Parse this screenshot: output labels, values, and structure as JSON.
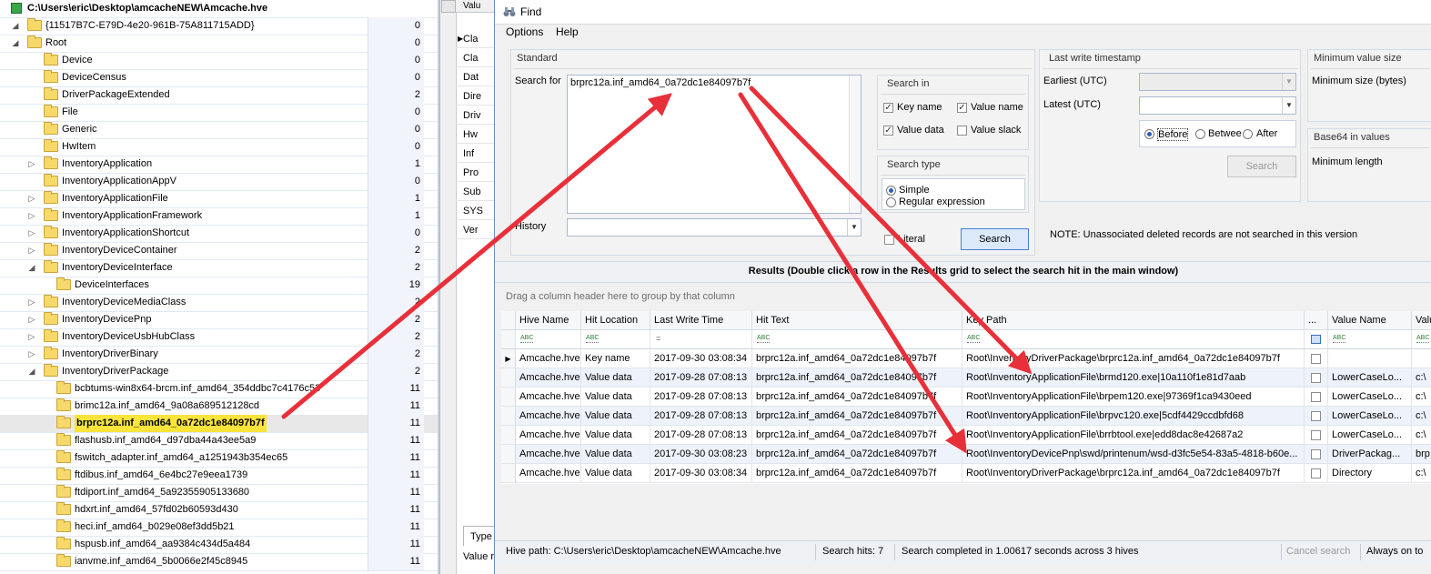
{
  "tree": {
    "root_path": "C:\\Users\\eric\\Desktop\\amcacheNEW\\Amcache.hve",
    "items": [
      {
        "label": "{11517B7C-E79D-4e20-961B-75A811715ADD}",
        "count": "0"
      },
      {
        "label": "Root",
        "count": "0"
      },
      {
        "label": "Device",
        "count": "0"
      },
      {
        "label": "DeviceCensus",
        "count": "0"
      },
      {
        "label": "DriverPackageExtended",
        "count": "2"
      },
      {
        "label": "File",
        "count": "0"
      },
      {
        "label": "Generic",
        "count": "0"
      },
      {
        "label": "HwItem",
        "count": "0"
      },
      {
        "label": "InventoryApplication",
        "count": "1"
      },
      {
        "label": "InventoryApplicationAppV",
        "count": "0"
      },
      {
        "label": "InventoryApplicationFile",
        "count": "1"
      },
      {
        "label": "InventoryApplicationFramework",
        "count": "1"
      },
      {
        "label": "InventoryApplicationShortcut",
        "count": "0"
      },
      {
        "label": "InventoryDeviceContainer",
        "count": "2"
      },
      {
        "label": "InventoryDeviceInterface",
        "count": "2"
      },
      {
        "label": "DeviceInterfaces",
        "count": "19"
      },
      {
        "label": "InventoryDeviceMediaClass",
        "count": "2"
      },
      {
        "label": "InventoryDevicePnp",
        "count": "2"
      },
      {
        "label": "InventoryDeviceUsbHubClass",
        "count": "2"
      },
      {
        "label": "InventoryDriverBinary",
        "count": "2"
      },
      {
        "label": "InventoryDriverPackage",
        "count": "2"
      },
      {
        "label": "bcbtums-win8x64-brcm.inf_amd64_354ddbc7c4176c53",
        "count": "11"
      },
      {
        "label": "brimc12a.inf_amd64_9a08a689512128cd",
        "count": "11"
      },
      {
        "label": "brprc12a.inf_amd64_0a72dc1e84097b7f",
        "count": "11"
      },
      {
        "label": "flashusb.inf_amd64_d97dba44a43ee5a9",
        "count": "11"
      },
      {
        "label": "fswitch_adapter.inf_amd64_a1251943b354ec65",
        "count": "11"
      },
      {
        "label": "ftdibus.inf_amd64_6e4bc27e9eea1739",
        "count": "11"
      },
      {
        "label": "ftdiport.inf_amd64_5a92355905133680",
        "count": "11"
      },
      {
        "label": "hdxrt.inf_amd64_57fd02b60593d430",
        "count": "11"
      },
      {
        "label": "heci.inf_amd64_b029e08ef3dd5b21",
        "count": "11"
      },
      {
        "label": "hspusb.inf_amd64_aa9384c434d5a484",
        "count": "11"
      },
      {
        "label": "ianvme.inf_amd64_5b0066e2f45c8945",
        "count": "11"
      }
    ]
  },
  "middle": {
    "header": "Valu",
    "rows": [
      "Cla",
      "Cla",
      "Dat",
      "Dire",
      "Driv",
      "Hw",
      "Inf",
      "Pro",
      "Sub",
      "SYS",
      "Ver"
    ],
    "type_tab": "Type",
    "value_label": "Value n"
  },
  "find": {
    "title": "Find",
    "menu": [
      "Options",
      "Help"
    ],
    "standard": {
      "title": "Standard",
      "search_for_label": "Search for",
      "search_for_value": "brprc12a.inf_amd64_0a72dc1e84097b7f",
      "history_label": "History",
      "literal_label": "Literal",
      "search_button": "Search"
    },
    "search_in": {
      "title": "Search in",
      "key_name": "Key name",
      "value_name": "Value name",
      "value_data": "Value data",
      "value_slack": "Value slack"
    },
    "search_type": {
      "title": "Search type",
      "simple": "Simple",
      "regex": "Regular expression"
    },
    "timestamp": {
      "title": "Last write timestamp",
      "earliest": "Earliest (UTC)",
      "latest": "Latest (UTC)",
      "before": "Before",
      "between": "Betwee",
      "after": "After",
      "search_button": "Search"
    },
    "min_value": {
      "title": "Minimum value size",
      "label": "Minimum size (bytes)"
    },
    "base64": {
      "title": "Base64 in values",
      "label": "Minimum length"
    },
    "note": "NOTE: Unassociated deleted records are not searched in this version",
    "results_title": "Results (Double click a row in the Results grid to select the search hit in the main window)",
    "group_hint": "Drag a column header here to group by that column",
    "columns": [
      "Hive Name",
      "Hit Location",
      "Last Write Time",
      "Hit Text",
      "Key Path",
      "...",
      "Value Name",
      "Valu"
    ],
    "filter_glyph": "ABC",
    "rows": [
      {
        "hive": "Amcache.hve",
        "loc": "Key name",
        "time": "2017-09-30 03:08:34",
        "hit": "brprc12a.inf_amd64_0a72dc1e84097b7f",
        "path": "Root\\InventoryDriverPackage\\brprc12a.inf_amd64_0a72dc1e84097b7f",
        "vname": "",
        "val": ""
      },
      {
        "hive": "Amcache.hve",
        "loc": "Value data",
        "time": "2017-09-28 07:08:13",
        "hit": "brprc12a.inf_amd64_0a72dc1e84097b7f",
        "path": "Root\\InventoryApplicationFile\\brmd120.exe|10a110f1e81d7aab",
        "vname": "LowerCaseLo...",
        "val": "c:\\"
      },
      {
        "hive": "Amcache.hve",
        "loc": "Value data",
        "time": "2017-09-28 07:08:13",
        "hit": "brprc12a.inf_amd64_0a72dc1e84097b7f",
        "path": "Root\\InventoryApplicationFile\\brpem120.exe|97369f1ca9430eed",
        "vname": "LowerCaseLo...",
        "val": "c:\\"
      },
      {
        "hive": "Amcache.hve",
        "loc": "Value data",
        "time": "2017-09-28 07:08:13",
        "hit": "brprc12a.inf_amd64_0a72dc1e84097b7f",
        "path": "Root\\InventoryApplicationFile\\brpvc120.exe|5cdf4429ccdbfd68",
        "vname": "LowerCaseLo...",
        "val": "c:\\"
      },
      {
        "hive": "Amcache.hve",
        "loc": "Value data",
        "time": "2017-09-28 07:08:13",
        "hit": "brprc12a.inf_amd64_0a72dc1e84097b7f",
        "path": "Root\\InventoryApplicationFile\\brrbtool.exe|edd8dac8e42687a2",
        "vname": "LowerCaseLo...",
        "val": "c:\\"
      },
      {
        "hive": "Amcache.hve",
        "loc": "Value data",
        "time": "2017-09-30 03:08:23",
        "hit": "brprc12a.inf_amd64_0a72dc1e84097b7f",
        "path": "Root\\InventoryDevicePnp\\swd/printenum/wsd-d3fc5e54-83a5-4818-b60e...",
        "vname": "DriverPackag...",
        "val": "brp"
      },
      {
        "hive": "Amcache.hve",
        "loc": "Value data",
        "time": "2017-09-30 03:08:34",
        "hit": "brprc12a.inf_amd64_0a72dc1e84097b7f",
        "path": "Root\\InventoryDriverPackage\\brprc12a.inf_amd64_0a72dc1e84097b7f",
        "vname": "Directory",
        "val": "c:\\"
      }
    ],
    "status": {
      "hive_path": "Hive path: C:\\Users\\eric\\Desktop\\amcacheNEW\\Amcache.hve",
      "hits": "Search hits: 7",
      "completed": "Search completed in 1.00617 seconds across 3 hives",
      "cancel": "Cancel search",
      "always_on_top": "Always on to"
    }
  },
  "colors": {
    "highlight": "#f9e43b",
    "arrow": "#e8303a",
    "folder": "#f7d96a",
    "accent": "#4a7fcf"
  }
}
